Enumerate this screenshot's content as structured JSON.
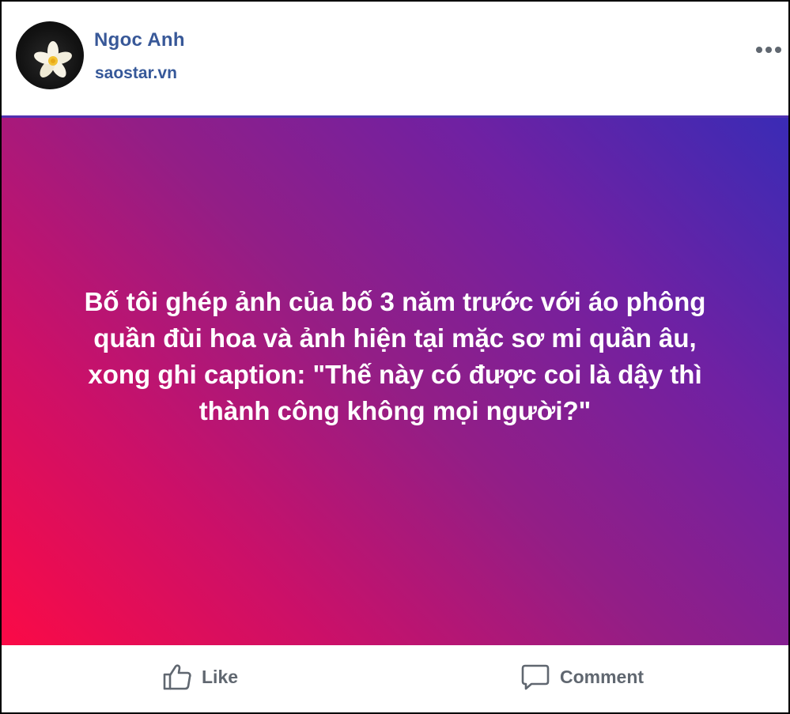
{
  "post": {
    "author": {
      "name": "Ngoc Anh",
      "subtitle": "saostar.vn",
      "avatar_icon": "plumeria-flower-avatar"
    },
    "more_icon": "more-options-icon",
    "background_colors": [
      "#fb0a46",
      "#931e86",
      "#3a2bb5"
    ],
    "text_lines": [
      "Bố tôi ghép ảnh của bố 3 năm trước với áo phông",
      "quần đùi hoa và ảnh hiện tại mặc sơ mi quần âu,",
      "xong ghi caption: \"Thế này có được coi là dậy thì",
      "thành công không mọi người?\""
    ]
  },
  "actions": {
    "like_label": "Like",
    "like_icon": "thumbs-up-icon",
    "comment_label": "Comment",
    "comment_icon": "comment-bubble-icon"
  }
}
